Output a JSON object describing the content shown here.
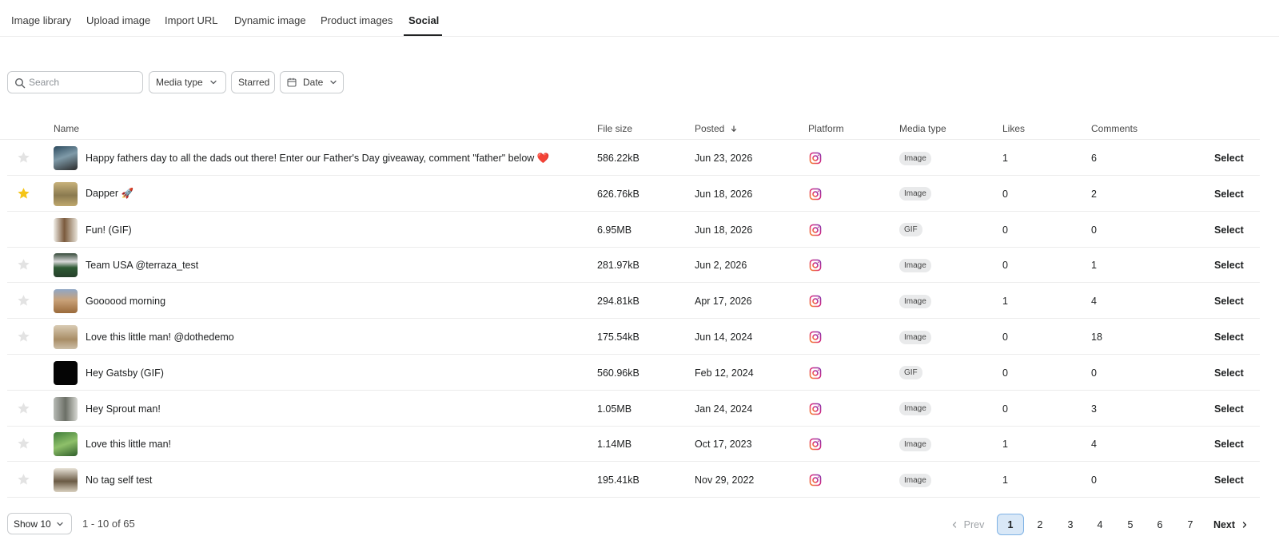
{
  "tabs": [
    {
      "label": "Image library"
    },
    {
      "label": "Upload image"
    },
    {
      "label": "Import URL"
    },
    {
      "label": "Dynamic image"
    },
    {
      "label": "Product images"
    },
    {
      "label": "Social"
    }
  ],
  "active_tab": "Social",
  "filters": {
    "search_placeholder": "Search",
    "media_type_label": "Media type",
    "starred_label": "Starred",
    "date_label": "Date"
  },
  "table": {
    "columns": {
      "name": "Name",
      "file_size": "File size",
      "posted": "Posted",
      "posted_sort_icon": "arrow-down",
      "platform": "Platform",
      "media_type": "Media type",
      "likes": "Likes",
      "comments": "Comments"
    },
    "rows": [
      {
        "starred": false,
        "star_visible": true,
        "name": "Happy fathers day to all the dads out there! Enter our Father's Day giveaway, comment \"father\" below ❤️",
        "file_size": "586.22kB",
        "posted": "Jun 23, 2026",
        "platform": "instagram",
        "media_type": "Image",
        "likes": "1",
        "comments": "6",
        "action": "Select"
      },
      {
        "starred": true,
        "star_visible": true,
        "name": "Dapper 🚀",
        "file_size": "626.76kB",
        "posted": "Jun 18, 2026",
        "platform": "instagram",
        "media_type": "Image",
        "likes": "0",
        "comments": "2",
        "action": "Select"
      },
      {
        "starred": false,
        "star_visible": false,
        "name": "Fun! (GIF)",
        "file_size": "6.95MB",
        "posted": "Jun 18, 2026",
        "platform": "instagram",
        "media_type": "GIF",
        "likes": "0",
        "comments": "0",
        "action": "Select"
      },
      {
        "starred": false,
        "star_visible": true,
        "name": "Team USA @terraza_test",
        "file_size": "281.97kB",
        "posted": "Jun 2, 2026",
        "platform": "instagram",
        "media_type": "Image",
        "likes": "0",
        "comments": "1",
        "action": "Select"
      },
      {
        "starred": false,
        "star_visible": true,
        "name": "Goooood morning",
        "file_size": "294.81kB",
        "posted": "Apr 17, 2026",
        "platform": "instagram",
        "media_type": "Image",
        "likes": "1",
        "comments": "4",
        "action": "Select"
      },
      {
        "starred": false,
        "star_visible": true,
        "name": "Love this little man! @dothedemo",
        "file_size": "175.54kB",
        "posted": "Jun 14, 2024",
        "platform": "instagram",
        "media_type": "Image",
        "likes": "0",
        "comments": "18",
        "action": "Select"
      },
      {
        "starred": false,
        "star_visible": false,
        "name": "Hey Gatsby (GIF)",
        "file_size": "560.96kB",
        "posted": "Feb 12, 2024",
        "platform": "instagram",
        "media_type": "GIF",
        "likes": "0",
        "comments": "0",
        "action": "Select"
      },
      {
        "starred": false,
        "star_visible": true,
        "name": "Hey Sprout man!",
        "file_size": "1.05MB",
        "posted": "Jan 24, 2024",
        "platform": "instagram",
        "media_type": "Image",
        "likes": "0",
        "comments": "3",
        "action": "Select"
      },
      {
        "starred": false,
        "star_visible": true,
        "name": "Love this little man!",
        "file_size": "1.14MB",
        "posted": "Oct 17, 2023",
        "platform": "instagram",
        "media_type": "Image",
        "likes": "1",
        "comments": "4",
        "action": "Select"
      },
      {
        "starred": false,
        "star_visible": true,
        "name": "No tag self test",
        "file_size": "195.41kB",
        "posted": "Nov 29, 2022",
        "platform": "instagram",
        "media_type": "Image",
        "likes": "1",
        "comments": "0",
        "action": "Select"
      }
    ]
  },
  "footer": {
    "show_label": "Show 10",
    "range_label": "1 - 10 of 65",
    "prev_label": "Prev",
    "next_label": "Next",
    "pages": [
      "1",
      "2",
      "3",
      "4",
      "5",
      "6",
      "7"
    ],
    "current_page": "1"
  },
  "colors": {
    "star_active": "#f5c518",
    "star_inactive": "#e3e3e3",
    "active_page_bg": "#d9e8f7",
    "active_page_border": "#7fb2e5"
  }
}
